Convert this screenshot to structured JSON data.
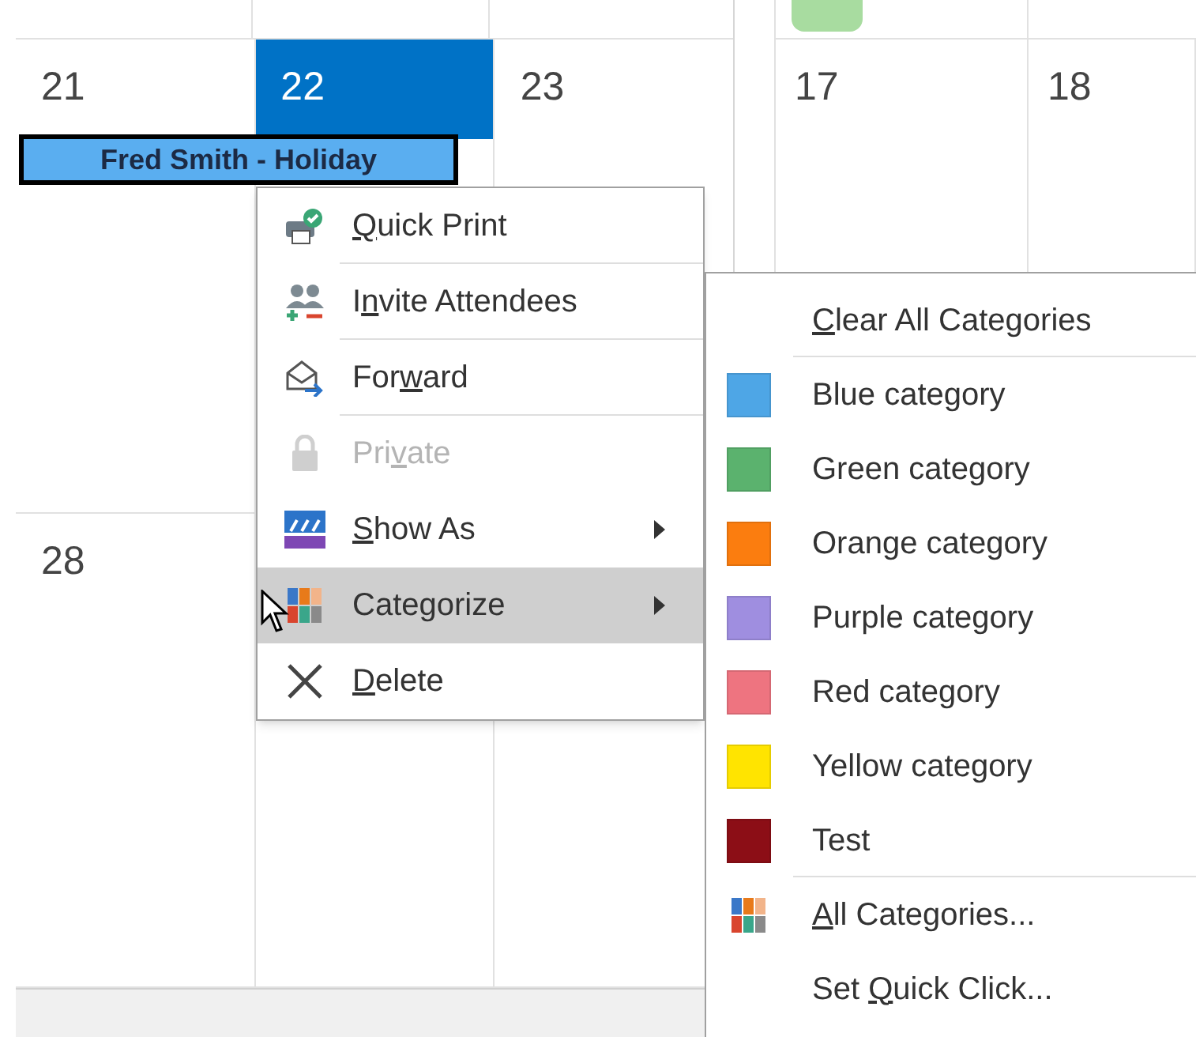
{
  "left_calendar": {
    "weeks": [
      {
        "days": [
          {
            "label": "21",
            "selected": false
          },
          {
            "label": "22",
            "selected": true
          },
          {
            "label": "23",
            "selected": false
          }
        ],
        "events": [
          {
            "title": "Fred Smith - Holiday",
            "selected": true,
            "color": "#5aaef0"
          }
        ]
      },
      {
        "days": [
          {
            "label": "28",
            "selected": false
          }
        ]
      }
    ]
  },
  "right_calendar": {
    "days": [
      {
        "label": "17",
        "selected": false
      },
      {
        "label": "18",
        "selected": false
      }
    ],
    "events": [
      {
        "color": "#a8dca0"
      }
    ]
  },
  "context_menu": {
    "items": [
      {
        "label": {
          "key": "Q",
          "post": "uick Print"
        },
        "disabled": false,
        "submenu": false,
        "selected": false,
        "separator_after": true
      },
      {
        "label": {
          "pre": "I",
          "key": "n",
          "post": "vite Attendees"
        },
        "disabled": false,
        "submenu": false,
        "selected": false,
        "separator_after": true
      },
      {
        "label": {
          "pre": "For",
          "key": "w",
          "post": "ard"
        },
        "disabled": false,
        "submenu": false,
        "selected": false,
        "separator_after": true
      },
      {
        "label": {
          "pre": "Pri",
          "key": "v",
          "post": "ate"
        },
        "disabled": true,
        "submenu": false,
        "selected": false,
        "separator_after": false
      },
      {
        "label": {
          "key": "S",
          "post": "how As"
        },
        "disabled": false,
        "submenu": true,
        "selected": false,
        "separator_after": false
      },
      {
        "label": {
          "pre": "Categorize"
        },
        "disabled": false,
        "submenu": true,
        "selected": true,
        "separator_after": false
      },
      {
        "label": {
          "key": "D",
          "post": "elete"
        },
        "disabled": false,
        "submenu": false,
        "selected": false,
        "separator_after": false
      }
    ]
  },
  "category_menu": {
    "items": [
      {
        "kind": "plain",
        "label": {
          "key": "C",
          "post": "lear All Categories"
        },
        "separator_after": true
      },
      {
        "kind": "color",
        "label": {
          "pre": "Blue category"
        },
        "color": "#4ea6e6",
        "separator_after": false
      },
      {
        "kind": "color",
        "label": {
          "pre": "Green category"
        },
        "color": "#5bb26e",
        "separator_after": false
      },
      {
        "kind": "color",
        "label": {
          "pre": "Orange category"
        },
        "color": "#fb7d0f",
        "separator_after": false
      },
      {
        "kind": "color",
        "label": {
          "pre": "Purple category"
        },
        "color": "#9f8ee0",
        "separator_after": false
      },
      {
        "kind": "color",
        "label": {
          "pre": "Red category"
        },
        "color": "#ee7480",
        "separator_after": false
      },
      {
        "kind": "color",
        "label": {
          "pre": "Yellow category"
        },
        "color": "#ffe400",
        "separator_after": false
      },
      {
        "kind": "color",
        "label": {
          "pre": "Test"
        },
        "color": "#8c0e16",
        "separator_after": true
      },
      {
        "kind": "grid",
        "label": {
          "key": "A",
          "post": "ll Categories..."
        },
        "separator_after": false
      },
      {
        "kind": "plain",
        "label": {
          "pre": "Set ",
          "key": "Q",
          "post": "uick Click..."
        },
        "separator_after": false
      }
    ]
  }
}
